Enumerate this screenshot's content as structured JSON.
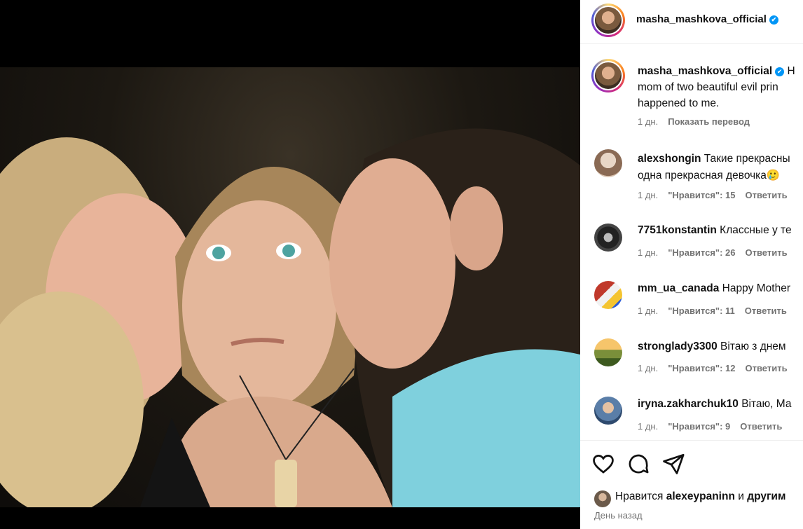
{
  "post": {
    "author": "masha_mashkova_official",
    "caption_lines": [
      "H",
      "mom of two beautiful evil prin",
      "happened to me."
    ],
    "caption_time": "1 дн.",
    "translate_label": "Показать перевод"
  },
  "comments": [
    {
      "user": "alexshongin",
      "lines": [
        "Такие прекрасны",
        "одна прекрасная девочка🥲"
      ],
      "time": "1 дн.",
      "likes": "\"Нравится\": 15",
      "reply": "Ответить"
    },
    {
      "user": "7751konstantin",
      "lines": [
        "Классные у те"
      ],
      "time": "1 дн.",
      "likes": "\"Нравится\": 26",
      "reply": "Ответить"
    },
    {
      "user": "mm_ua_canada",
      "lines": [
        "Happy Mother"
      ],
      "time": "1 дн.",
      "likes": "\"Нравится\": 11",
      "reply": "Ответить"
    },
    {
      "user": "stronglady3300",
      "lines": [
        "Вітаю з днем"
      ],
      "time": "1 дн.",
      "likes": "\"Нравится\": 12",
      "reply": "Ответить"
    },
    {
      "user": "iryna.zakharchuk10",
      "lines": [
        "Вітаю, Ма"
      ],
      "time": "1 дн.",
      "likes": "\"Нравится\": 9",
      "reply": "Ответить"
    }
  ],
  "likes_line": {
    "prefix": "Нравится",
    "user": "alexeypaninn",
    "middle": "и",
    "suffix": "другим"
  },
  "posted_ago": "День назад",
  "icons": {
    "like": "heart-icon",
    "comment": "comment-icon",
    "share": "share-icon",
    "verified": "verified-badge-icon"
  },
  "colors": {
    "verified": "#0095f6",
    "meta": "#737373",
    "text": "#111111"
  }
}
